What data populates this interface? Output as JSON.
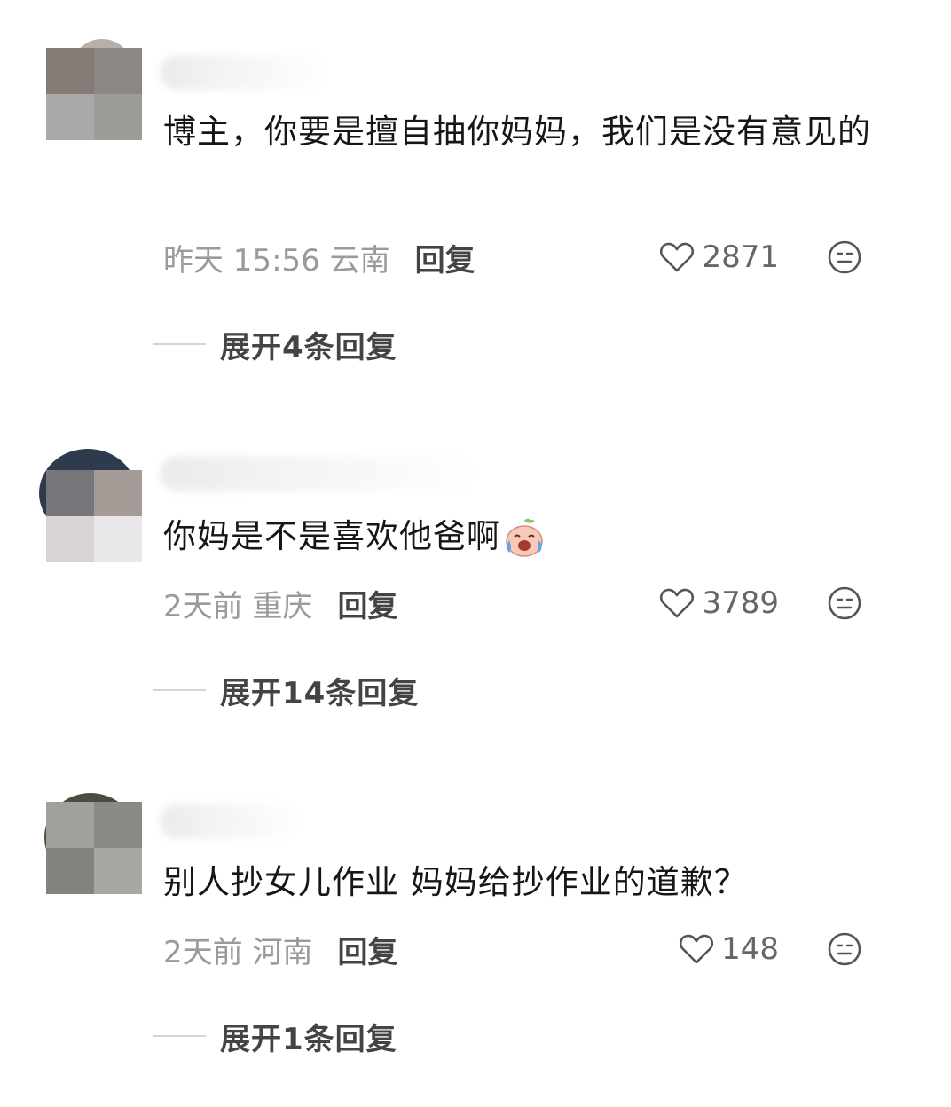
{
  "comments": [
    {
      "text": "博主，你要是擅自抽你妈妈，我们是没有意见的",
      "time_location": "昨天 15:56 云南",
      "reply_label": "回复",
      "likes": "2871",
      "expand_label": "展开4条回复"
    },
    {
      "text": "你妈是不是喜欢他爸啊",
      "sticker": "crying-laughing-sticker",
      "time_location": "2天前 重庆",
      "reply_label": "回复",
      "likes": "3789",
      "expand_label": "展开14条回复"
    },
    {
      "text": "别人抄女儿作业 妈妈给抄作业的道歉？",
      "time_location": "2天前 河南",
      "reply_label": "回复",
      "likes": "148",
      "expand_label": "展开1条回复"
    }
  ],
  "icons": {
    "like": "heart-outline-icon",
    "emoji": "neutral-face-icon"
  },
  "colors": {
    "text": "#161616",
    "meta": "#9a9a9a",
    "action": "#444444"
  }
}
